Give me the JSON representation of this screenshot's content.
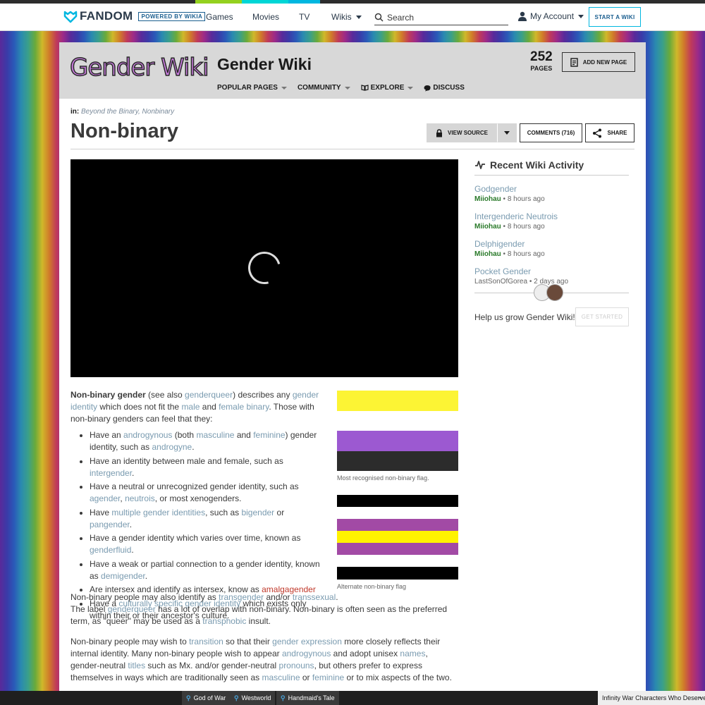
{
  "global_nav": {
    "brand": "FANDOM",
    "powered_by": "POWERED BY WIKIA",
    "links": [
      "Games",
      "Movies",
      "TV",
      "Wikis"
    ],
    "search_placeholder": "Search",
    "account_label": "My Account",
    "start_wiki_label": "START A WIKI",
    "stripe_colors": [
      "#94d11f",
      "#00d6d6",
      "#00b7e0"
    ]
  },
  "wiki": {
    "wordmark": "Gender Wiki",
    "title": "Gender Wiki",
    "page_count": "252",
    "page_count_label": "PAGES",
    "add_page_label": "ADD NEW PAGE",
    "nav": [
      "POPULAR PAGES",
      "COMMUNITY",
      "EXPLORE",
      "DISCUSS"
    ]
  },
  "article": {
    "categories_label": "in:",
    "categories": "Beyond the Binary, Nonbinary",
    "title": "Non-binary",
    "view_source_label": "VIEW SOURCE",
    "comments_label": "COMMENTS (716)",
    "share_label": "SHARE",
    "flag1_caption": "Most recognised non-binary flag.",
    "flag2_caption": "Alternate non-binary flag",
    "flag1_colors": [
      "#fcf434",
      "#ffffff",
      "#9c59d1",
      "#2c2c2c"
    ],
    "flag2_colors": [
      "#000000",
      "#ffffff",
      "#a24aa5",
      "#fff200",
      "#a24aa5",
      "#ffffff",
      "#000000"
    ]
  },
  "rail": {
    "heading": "Recent Wiki Activity",
    "activities": [
      {
        "title": "Godgender",
        "user": "Miiohau",
        "time": "8 hours ago"
      },
      {
        "title": "Intergenderic Neutrois",
        "user": "Miiohau",
        "time": "8 hours ago"
      },
      {
        "title": "Delphigender",
        "user": "Miiohau",
        "time": "8 hours ago"
      },
      {
        "title": "Pocket Gender",
        "user": "LastSonOfGorea",
        "time": "2 days ago"
      }
    ],
    "help_text": "Help us grow Gender Wiki!",
    "get_started_label": "GET STARTED"
  },
  "bottom_bar": {
    "tabs": [
      "God of War",
      "Westworld",
      "Handmaid's Tale"
    ],
    "right_text": "Infinity War Characters Who Deserve"
  }
}
